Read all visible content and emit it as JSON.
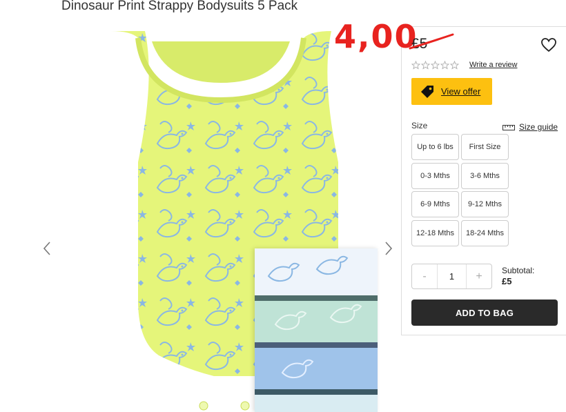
{
  "product": {
    "title": "Dinosaur Print Strappy Bodysuits 5 Pack",
    "price_new": "4,00",
    "price_old": "£5"
  },
  "reviews": {
    "stars_filled": 0,
    "stars_total": 5,
    "link_label": "Write a review"
  },
  "offer": {
    "label": "View offer",
    "icon": "tag-icon"
  },
  "size": {
    "label": "Size",
    "guide_label": "Size guide",
    "options": [
      "Up to 6 lbs",
      "First Size",
      "0-3 Mths",
      "3-6 Mths",
      "6-9 Mths",
      "9-12 Mths",
      "12-18 Mths",
      "18-24 Mths"
    ]
  },
  "quantity": {
    "minus": "-",
    "value": "1",
    "plus": "+"
  },
  "subtotal": {
    "label": "Subtotal:",
    "amount": "£5"
  },
  "cart": {
    "add_label": "ADD TO BAG"
  },
  "colors": {
    "accent": "#fdc010",
    "price_red": "#e8231f",
    "button_dark": "#2a2a2a",
    "garment": "#e5f57a",
    "print": "#8ab7e3"
  }
}
